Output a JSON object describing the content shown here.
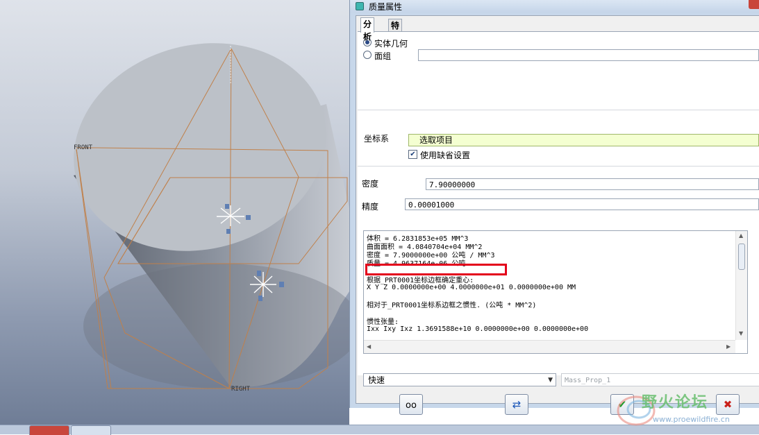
{
  "viewport": {
    "front_label": "FRONT",
    "right_label": "RIGHT",
    "csys_labels": [
      "X",
      "Y",
      "Z"
    ]
  },
  "dialog": {
    "title": "质量属性",
    "tabs": [
      {
        "label": "分析",
        "active": true
      },
      {
        "label": "特征",
        "active": false
      }
    ],
    "geometry_options": [
      {
        "label": "实体几何",
        "selected": true
      },
      {
        "label": "面组",
        "selected": false
      }
    ],
    "coord_system": {
      "label": "坐标系",
      "select_text": "选取项目",
      "use_default_label": "使用缺省设置",
      "use_default_checked": true
    },
    "density": {
      "label": "密度",
      "value": "7.90000000"
    },
    "accuracy": {
      "label": "精度",
      "value": "0.00001000"
    },
    "results": [
      "体积 =  6.2831853e+05  MM^3",
      "曲面面积 =  4.0840704e+04  MM^2",
      "密度 =  7.9000000e+00 公吨 / MM^3",
      "质量 =  4.9637164e-06 公吨",
      "根据_PRT0001坐标边框确定重心:",
      "X  Y  Z  0.0000000e+00  4.0000000e+01  0.0000000e+00  MM",
      "相对于_PRT0001坐标系边框之惯性.  (公吨 * MM^2)",
      "惯性张量:",
      "Ixx Ixy Ixz  1.3691588e+10  0.0000000e+00  0.0000000e+00"
    ],
    "mode": {
      "value": "快速"
    },
    "feature_name": {
      "placeholder": "Mass_Prop_1"
    },
    "buttons": {
      "preview_icon": "glasses-icon",
      "repeat_icon": "refresh-icon",
      "ok_icon": "checkmark-icon",
      "cancel_icon": "x-icon"
    }
  },
  "watermark": {
    "title": "野火论坛",
    "url": "www.proewildfire.cn"
  },
  "colors": {
    "accent_select": "#f4ffd1",
    "highlight_box": "#e3001b",
    "datum_plane": "#c0804a"
  }
}
